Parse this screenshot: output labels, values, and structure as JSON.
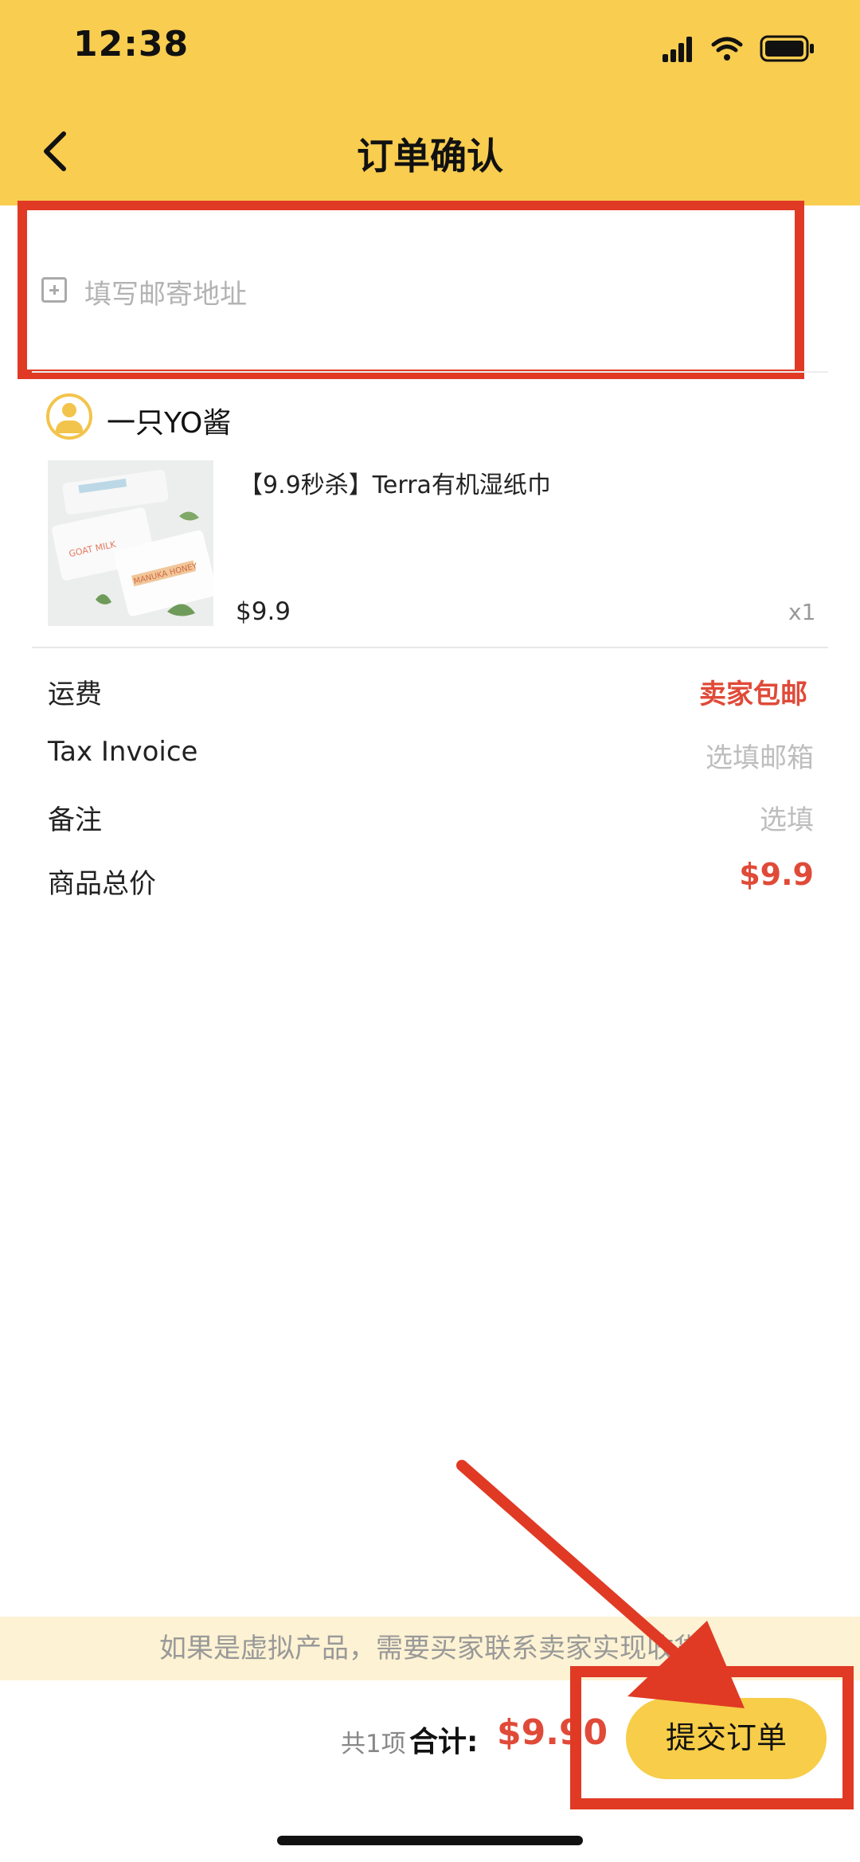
{
  "status_bar": {
    "time": "12:38"
  },
  "header": {
    "title": "订单确认"
  },
  "address": {
    "placeholder": "填写邮寄地址"
  },
  "seller": {
    "name": "一只YO酱"
  },
  "product": {
    "name": "【9.9秒杀】Terra有机湿纸巾",
    "price": "$9.9",
    "quantity": "x1",
    "image_text_1": "GOAT MILK",
    "image_text_2": "MANUKA HONEY"
  },
  "details": [
    {
      "label": "运费",
      "value": "卖家包邮",
      "style": "red-bold"
    },
    {
      "label": "Tax Invoice",
      "value": "选填邮箱",
      "style": "grey"
    },
    {
      "label": "备注",
      "value": "选填",
      "style": "grey"
    },
    {
      "label": "商品总价",
      "value": "$9.9",
      "style": "red-bold"
    }
  ],
  "footer": {
    "notice": "如果是虚拟产品，需要买家联系卖家实现收货",
    "count": "共1项",
    "total_label": "合计:",
    "total_value": "$9.90",
    "submit_label": "提交订单"
  },
  "colors": {
    "header_bg": "#f8cd50",
    "accent_red": "#e04a38",
    "annotation_red": "#e03a25",
    "button_yellow": "#f7cd49"
  }
}
